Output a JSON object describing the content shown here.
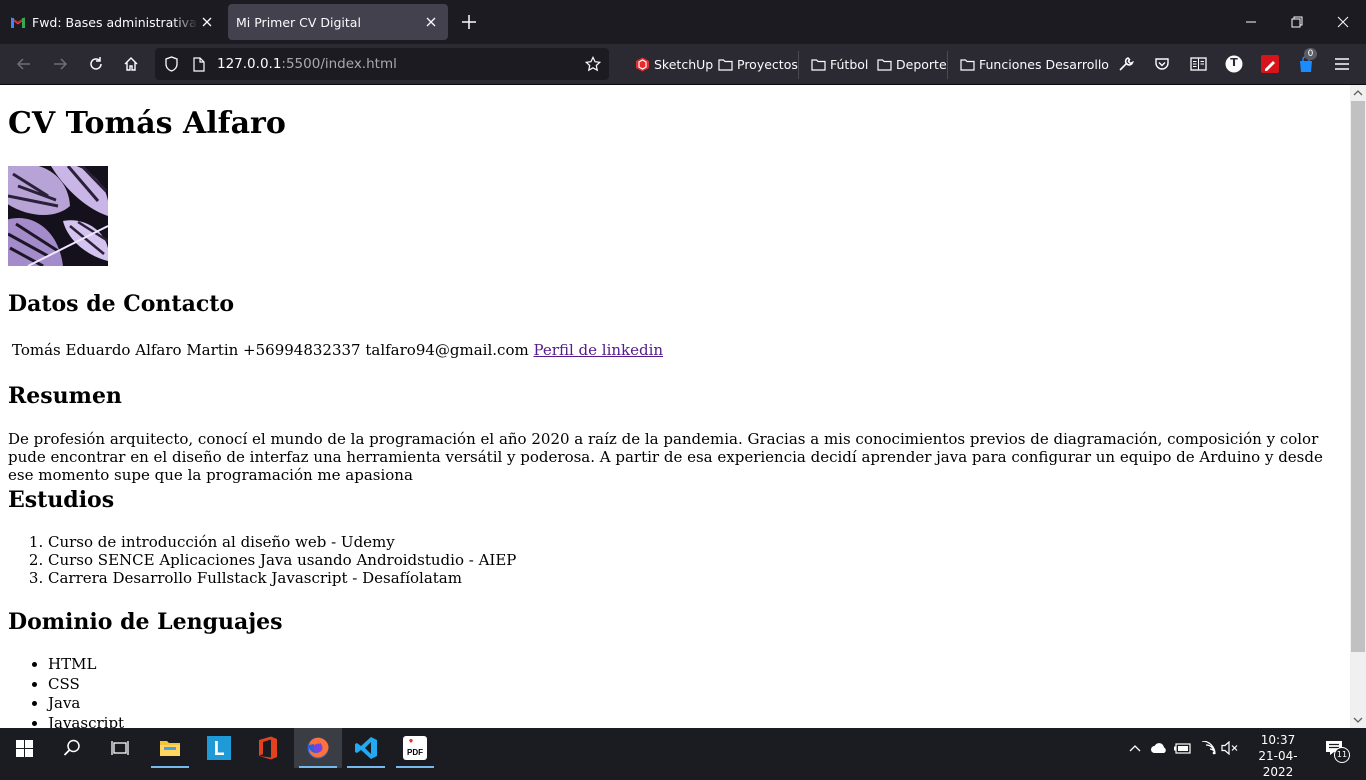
{
  "browser": {
    "tabs": [
      {
        "title": "Fwd: Bases administrativas y técnicas",
        "active": false,
        "favicon": "gmail-icon"
      },
      {
        "title": "Mi Primer CV Digital",
        "active": true,
        "favicon": "none"
      }
    ],
    "url_host": "127.0.0.1",
    "url_rest": ":5500/index.html",
    "bookmarks": [
      {
        "label": "SketchUp",
        "icon": "sketchup-icon"
      },
      {
        "label": "Proyectos",
        "icon": "folder-icon"
      },
      {
        "label": "Fútbol",
        "icon": "folder-icon"
      },
      {
        "label": "Deporte",
        "icon": "folder-icon"
      },
      {
        "label": "Funciones Desarrollo",
        "icon": "folder-icon"
      }
    ],
    "extension_badge": "0",
    "account_initial": "T"
  },
  "page": {
    "title": "CV Tomás Alfaro",
    "contact_heading": "Datos de Contacto",
    "contact_text": "Tomás Eduardo Alfaro Martin +56994832337 talfaro94@gmail.com",
    "linkedin_label": "Perfil de linkedin",
    "summary_heading": "Resumen",
    "summary_text": "De profesión arquitecto, conocí el mundo de la programación el año 2020 a raíz de la pandemia. Gracias a mis conocimientos previos de diagramación, composición y color pude encontrar en el diseño de interfaz una herramienta versátil y poderosa. A partir de esa experiencia decidí aprender java para configurar un equipo de Arduino y desde ese momento supe que la programación me apasiona",
    "studies_heading": "Estudios",
    "studies": [
      "Curso de introducción al diseño web - Udemy",
      "Curso SENCE Aplicaciones Java usando Androidstudio - AIEP",
      "Carrera Desarrollo Fullstack Javascript - Desafíolatam"
    ],
    "languages_heading": "Dominio de Lenguajes",
    "languages": [
      "HTML",
      "CSS",
      "Java",
      "Javascript"
    ]
  },
  "taskbar": {
    "time": "10:37",
    "date": "21-04-2022",
    "notification_count": "11",
    "apps": [
      "windows-start-icon",
      "search-icon",
      "task-view-icon",
      "file-explorer-icon",
      "l-app-icon",
      "office-icon",
      "firefox-icon",
      "vscode-icon",
      "ilovepdf-icon"
    ]
  },
  "colors": {
    "chrome_dark": "#1c1b22",
    "toolbar": "#2b2a33",
    "active_tab": "#42414d",
    "visited_link": "#551a8b",
    "taskbar": "#1a1c22"
  }
}
